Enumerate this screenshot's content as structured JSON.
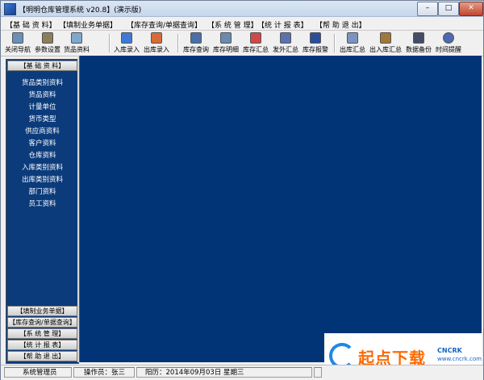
{
  "window": {
    "title": "【明明仓库管理系统 v20.8】(演示版)",
    "min_symbol": "–",
    "max_symbol": "□",
    "close_symbol": "✕"
  },
  "menu": [
    "【基 础 资 料】",
    "【填制业务单据】",
    "【库存查询/单据查询】",
    "【系 统 管 理】",
    "【统 计 报 表】",
    "【帮 助 退 出】"
  ],
  "toolbar": [
    {
      "label": "关闭导航",
      "icon": "close-nav-icon",
      "color": "#6b8fb8"
    },
    {
      "label": "参数设置",
      "icon": "settings-icon",
      "color": "#8a7f5a"
    },
    {
      "label": "货品资料",
      "icon": "goods-icon",
      "color": "#7fa8d1"
    },
    {
      "label": "入库录入",
      "icon": "stock-in-icon",
      "color": "#3d7ad6"
    },
    {
      "label": "出库录入",
      "icon": "stock-out-icon",
      "color": "#d86a3a"
    },
    {
      "label": "库存查询",
      "icon": "inventory-search-icon",
      "color": "#4a6fa8"
    },
    {
      "label": "库存明细",
      "icon": "inventory-detail-icon",
      "color": "#6a8ab0"
    },
    {
      "label": "库存汇总",
      "icon": "inventory-summary-icon",
      "color": "#d04848"
    },
    {
      "label": "发外汇总",
      "icon": "outsource-summary-icon",
      "color": "#5b72b0"
    },
    {
      "label": "库存报警",
      "icon": "inventory-alert-icon",
      "color": "#2a4f9a"
    },
    {
      "label": "出库汇总",
      "icon": "stock-out-summary-icon",
      "color": "#7b93c0"
    },
    {
      "label": "出入库汇总",
      "icon": "in-out-summary-icon",
      "color": "#a07838"
    },
    {
      "label": "数据备份",
      "icon": "backup-icon",
      "color": "#444c6a"
    },
    {
      "label": "时间提醒",
      "icon": "clock-icon",
      "color": "#4d6ab0"
    }
  ],
  "sidebar": {
    "top_header": "【基 础 资 料】",
    "items": [
      "货品类别资料",
      "货品资料",
      "计量单位",
      "货币类型",
      "供应商资料",
      "客户资料",
      "仓库资料",
      "入库类别资料",
      "出库类别资料",
      "部门资料",
      "员工资料"
    ],
    "bottom_headers": [
      "【填制业务单据】",
      "【库存查询/单据查询】",
      "【系 统 管 理】",
      "【统 计 报 表】",
      "【帮 助 退 出】"
    ]
  },
  "watermark": {
    "brand": "起点下载",
    "tag": "CNCRK",
    "url": "www.cncrk.com"
  },
  "status": {
    "role": "系统管理员",
    "operator": "操作员：张三",
    "date": "阳历：2014年09月03日 星期三"
  },
  "colors": {
    "main_bg": "#003477",
    "sidebar_bg": "#0b3b7b",
    "brand_orange": "#ff6a00",
    "brand_blue": "#1e88e5"
  }
}
